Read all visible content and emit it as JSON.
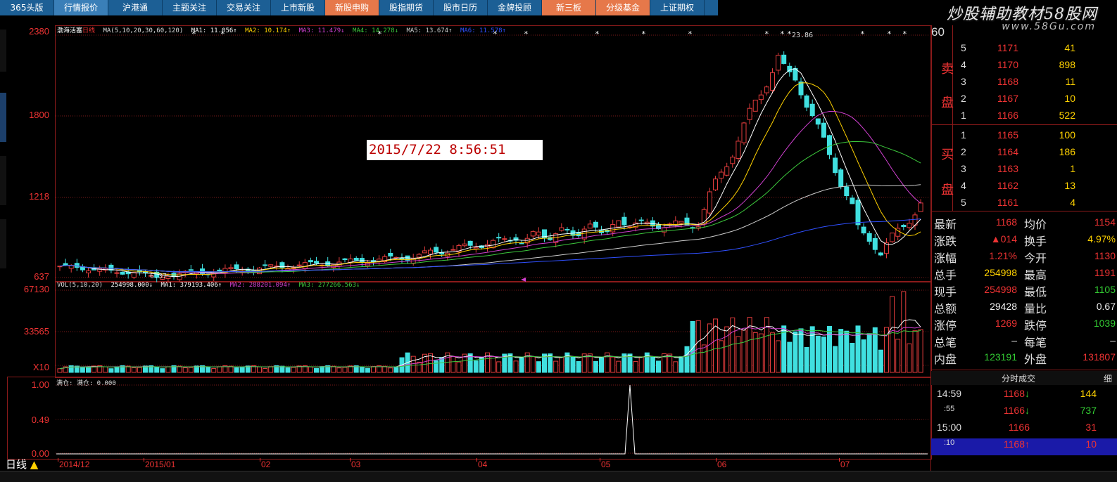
{
  "tabs": [
    {
      "label": "365头版",
      "style": "normal"
    },
    {
      "label": "行情报价",
      "style": "active"
    },
    {
      "label": "沪港通",
      "style": "normal"
    },
    {
      "label": "主题关注",
      "style": "normal"
    },
    {
      "label": "交易关注",
      "style": "normal"
    },
    {
      "label": "上市新股",
      "style": "normal"
    },
    {
      "label": "新股申购",
      "style": "orange"
    },
    {
      "label": "股指期货",
      "style": "normal"
    },
    {
      "label": "股市日历",
      "style": "normal"
    },
    {
      "label": "金牌投顾",
      "style": "normal"
    },
    {
      "label": "新三板",
      "style": "orange"
    },
    {
      "label": "分级基金",
      "style": "orange"
    },
    {
      "label": "上证期权",
      "style": "normal"
    }
  ],
  "brand": {
    "title": "炒股辅助教材58股网",
    "url": "www.58Gu.com"
  },
  "main_chart": {
    "stock_name": "渤海活塞",
    "period": "日线",
    "ma_params": "MA(5,10,20,30,60,120)",
    "ma_values": [
      {
        "label": "MA1: 11.056↑",
        "color": "#ffffff"
      },
      {
        "label": "MA2: 10.174↑",
        "color": "#ffd200"
      },
      {
        "label": "MA3: 11.479↓",
        "color": "#d040d0"
      },
      {
        "label": "MA4: 14.278↓",
        "color": "#3cc83c"
      },
      {
        "label": "MA5: 13.674↑",
        "color": "#cccccc"
      },
      {
        "label": "MA6: 11.578↑",
        "color": "#3050ff"
      }
    ],
    "y_ticks": [
      "2380",
      "1800",
      "1218",
      "637"
    ],
    "peak_label": "23.86",
    "low_label": "6.37",
    "datestamp": "2015/7/22 8:56:51"
  },
  "volume_chart": {
    "params": "VOL(5,10,20)",
    "values": [
      {
        "label": "254998.000↓",
        "color": "#ffffff"
      },
      {
        "label": "MA1: 379193.406↑",
        "color": "#ffffff"
      },
      {
        "label": "MA2: 288201.094↑",
        "color": "#d040d0"
      },
      {
        "label": "MA3: 277266.563↓",
        "color": "#3cc83c"
      }
    ],
    "y_ticks": [
      "67130",
      "33565",
      "X10"
    ]
  },
  "indicator_chart": {
    "label": "满仓: 满仓: 0.000",
    "y_ticks": [
      "1.00",
      "0.49",
      "0.00"
    ]
  },
  "x_axis": [
    "2014/12",
    "2015/01",
    "02",
    "03",
    "04",
    "05",
    "06",
    "07"
  ],
  "period_button": "日线",
  "colors": {
    "up": "#e33d3d",
    "down": "#40e0e0",
    "grid": "#8b1a1a",
    "tab_bg": "#1c5f95"
  },
  "order_book": {
    "header_num": "60",
    "sell_label": [
      "卖",
      "盘"
    ],
    "buy_label": [
      "买",
      "盘"
    ],
    "asks": [
      {
        "level": "5",
        "price": "1171",
        "vol": "41"
      },
      {
        "level": "4",
        "price": "1170",
        "vol": "898"
      },
      {
        "level": "3",
        "price": "1168",
        "vol": "11"
      },
      {
        "level": "2",
        "price": "1167",
        "vol": "10"
      },
      {
        "level": "1",
        "price": "1166",
        "vol": "522"
      }
    ],
    "bids": [
      {
        "level": "1",
        "price": "1165",
        "vol": "100"
      },
      {
        "level": "2",
        "price": "1164",
        "vol": "186"
      },
      {
        "level": "3",
        "price": "1163",
        "vol": "1"
      },
      {
        "level": "4",
        "price": "1162",
        "vol": "13"
      },
      {
        "level": "5",
        "price": "1161",
        "vol": "4"
      }
    ]
  },
  "quote": [
    {
      "l1": "最新",
      "v1": "1168",
      "c1": "red",
      "l2": "均价",
      "v2": "1154",
      "c2": "red"
    },
    {
      "l1": "涨跌",
      "v1": "▲014",
      "c1": "red",
      "l2": "换手",
      "v2": "4.97%",
      "c2": "yellow"
    },
    {
      "l1": "涨幅",
      "v1": "1.21%",
      "c1": "red",
      "l2": "今开",
      "v2": "1130",
      "c2": "red"
    },
    {
      "l1": "总手",
      "v1": "254998",
      "c1": "yellow",
      "l2": "最高",
      "v2": "1191",
      "c2": "red"
    },
    {
      "l1": "现手",
      "v1": "254998",
      "c1": "red",
      "l2": "最低",
      "v2": "1105",
      "c2": "green"
    },
    {
      "l1": "总额",
      "v1": "29428",
      "c1": "white",
      "l2": "量比",
      "v2": "0.67",
      "c2": "white"
    },
    {
      "l1": "涨停",
      "v1": "1269",
      "c1": "red",
      "l2": "跌停",
      "v2": "1039",
      "c2": "green"
    },
    {
      "l1": "总笔",
      "v1": "–",
      "c1": "white",
      "l2": "每笔",
      "v2": "–",
      "c2": "white"
    },
    {
      "l1": "内盘",
      "v1": "123191",
      "c1": "green",
      "l2": "外盘",
      "v2": "131807",
      "c2": "red"
    }
  ],
  "ticks_header": {
    "title": "分时成交",
    "detail": "细"
  },
  "ticks": [
    {
      "time": "14:59",
      "price": "1168",
      "arrow": "↓",
      "vol": "144",
      "pc": "red",
      "vc": "yellow"
    },
    {
      "time": ":55",
      "price": "1166",
      "arrow": "↓",
      "vol": "737",
      "pc": "red",
      "vc": "green"
    },
    {
      "time": "15:00",
      "price": "1166",
      "arrow": "",
      "vol": "31",
      "pc": "red",
      "vc": "red"
    },
    {
      "time": ":10",
      "price": "1168",
      "arrow": "↑",
      "vol": "10",
      "pc": "red",
      "vc": "red"
    }
  ]
}
